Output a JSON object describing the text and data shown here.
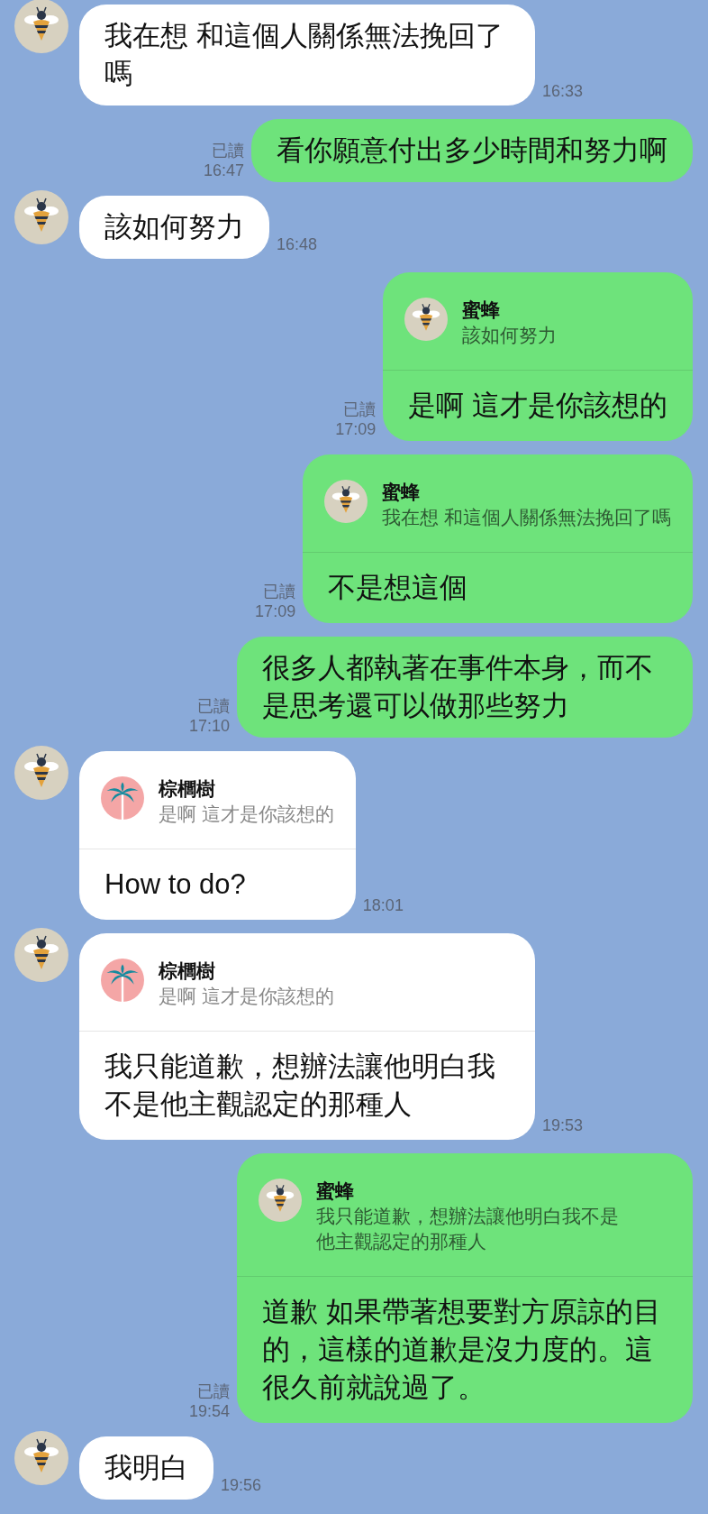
{
  "messages": [
    {
      "kind": "incoming",
      "avatar": {
        "kind": "bee"
      },
      "text": "我在想 和這個人關係無法挽回了嗎",
      "time": "16:33"
    },
    {
      "kind": "outgoing",
      "read": "已讀",
      "text": "看你願意付出多少時間和努力啊",
      "time": "16:47"
    },
    {
      "kind": "incoming",
      "avatar": {
        "kind": "bee"
      },
      "text": "該如何努力",
      "time": "16:48"
    },
    {
      "kind": "outgoing",
      "read": "已讀",
      "reply": {
        "avatar": {
          "kind": "bee"
        },
        "name": "蜜蜂",
        "text": "該如何努力"
      },
      "text": "是啊 這才是你該想的",
      "time": "17:09"
    },
    {
      "kind": "outgoing",
      "read": "已讀",
      "reply": {
        "avatar": {
          "kind": "bee"
        },
        "name": "蜜蜂",
        "text": "我在想 和這個人關係無法挽回了嗎"
      },
      "text": "不是想這個",
      "time": "17:09"
    },
    {
      "kind": "outgoing",
      "read": "已讀",
      "text": "很多人都執著在事件本身，而不是思考還可以做那些努力",
      "time": "17:10"
    },
    {
      "kind": "incoming",
      "avatar": {
        "kind": "bee"
      },
      "reply": {
        "avatar": {
          "kind": "palm"
        },
        "name": "棕櫚樹",
        "text": "是啊 這才是你該想的"
      },
      "text": "How to do?",
      "time": "18:01"
    },
    {
      "kind": "incoming",
      "avatar": {
        "kind": "bee"
      },
      "reply": {
        "avatar": {
          "kind": "palm"
        },
        "name": "棕櫚樹",
        "text": "是啊 這才是你該想的"
      },
      "text": "我只能道歉，想辦法讓他明白我不是他主觀認定的那種人",
      "time": "19:53"
    },
    {
      "kind": "outgoing",
      "read": "已讀",
      "reply": {
        "avatar": {
          "kind": "bee"
        },
        "name": "蜜蜂",
        "text": "我只能道歉，想辦法讓他明白我不是他主觀認定的那種人"
      },
      "text": "道歉 如果帶著想要對方原諒的目的，這樣的道歉是沒力度的。這很久前就說過了。",
      "time": "19:54"
    },
    {
      "kind": "incoming",
      "avatar": {
        "kind": "bee"
      },
      "text": "我明白",
      "time": "19:56"
    }
  ]
}
